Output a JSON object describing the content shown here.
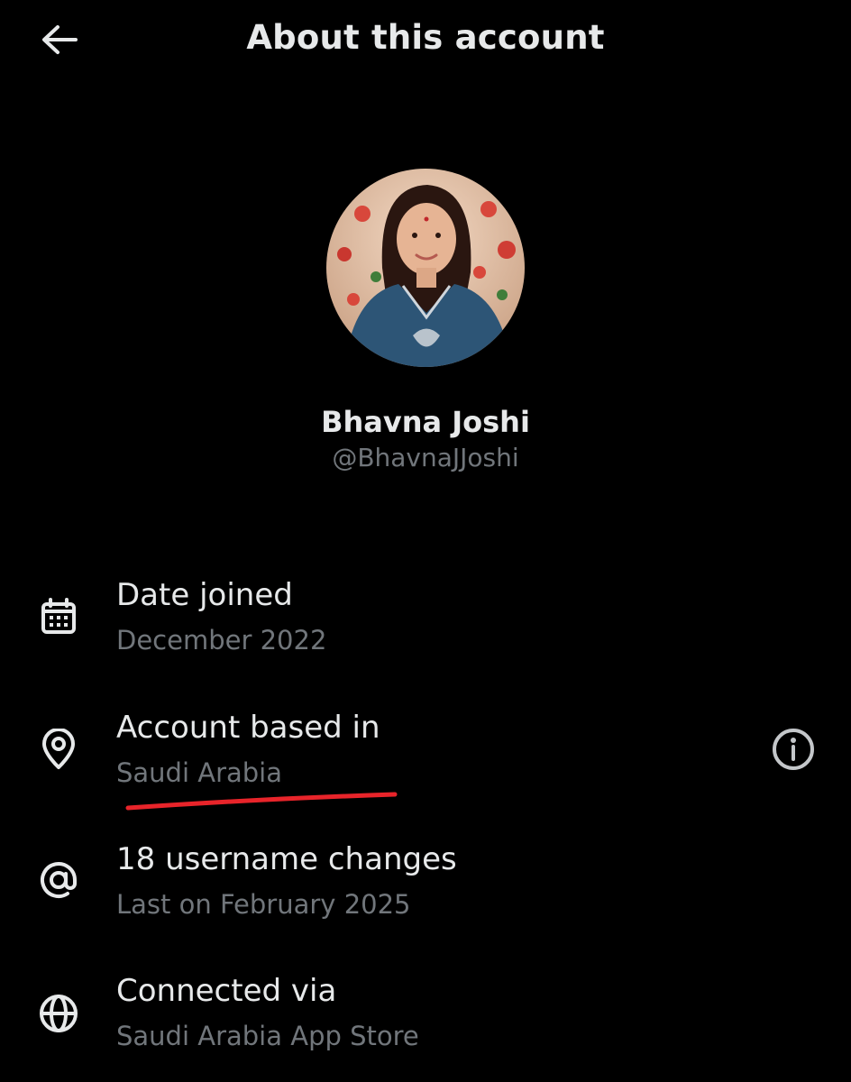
{
  "header": {
    "title": "About this account",
    "back_icon": "arrow-left-icon"
  },
  "profile": {
    "display_name": "Bhavna Joshi",
    "handle": "@BhavnaJJoshi",
    "avatar_icon": "profile-photo"
  },
  "details": [
    {
      "label": "Date joined",
      "value": "December 2022",
      "icon": "calendar-icon"
    },
    {
      "label": "Account based in",
      "value": "Saudi Arabia",
      "icon": "location-pin-icon"
    },
    {
      "label": "18 username changes",
      "value": "Last on February 2025",
      "icon": "at-sign-icon"
    },
    {
      "label": "Connected via",
      "value": "Saudi Arabia App Store",
      "icon": "globe-icon"
    }
  ],
  "colors": {
    "background": "#000000",
    "primary_text": "#e7e9ea",
    "secondary_text": "#71767b",
    "annotation": "#e8242a"
  }
}
